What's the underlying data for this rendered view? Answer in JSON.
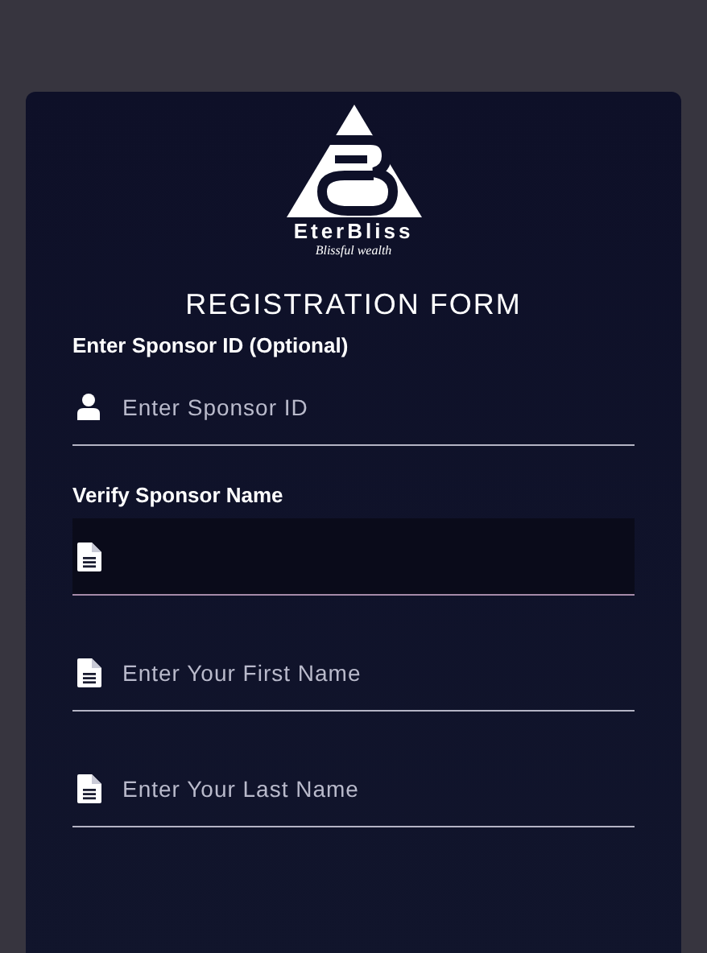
{
  "logo": {
    "name": "EterBliss",
    "tagline": "Blissful wealth"
  },
  "form": {
    "title": "REGISTRATION FORM",
    "fields": [
      {
        "label": "Enter Sponsor ID (Optional)",
        "kind": "user",
        "placeholder": "Enter Sponsor ID",
        "readonly": false
      },
      {
        "label": "Verify Sponsor Name",
        "kind": "document",
        "readonly": true
      },
      {
        "kind": "document",
        "placeholder": "Enter Your First Name",
        "readonly": false
      },
      {
        "kind": "document",
        "placeholder": "Enter Your Last Name",
        "readonly": false
      }
    ]
  }
}
